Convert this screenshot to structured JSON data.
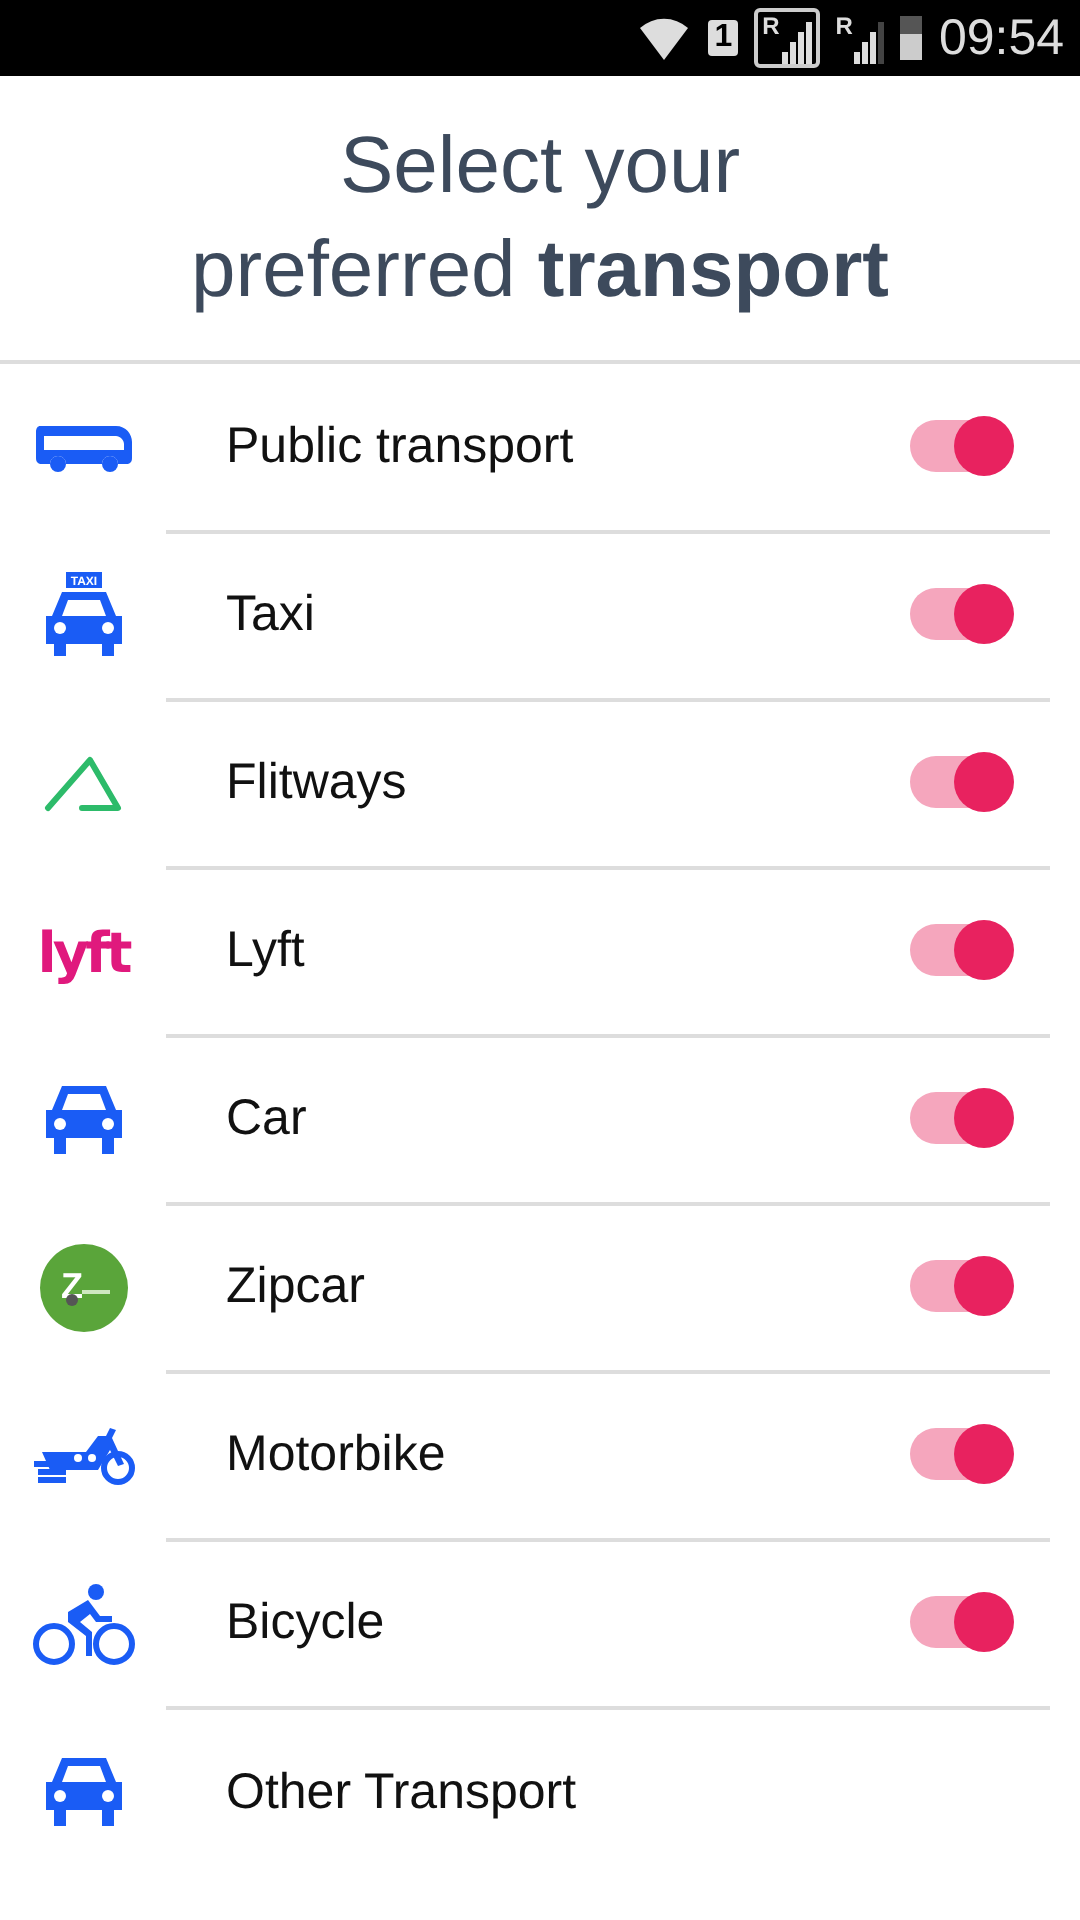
{
  "status_bar": {
    "sim_slot": "1",
    "roaming_marks": [
      "R",
      "R"
    ],
    "time": "09:54"
  },
  "title": "Select your\npreferred **transport**",
  "options": [
    {
      "label": "Public transport",
      "on": true
    },
    {
      "label": "Taxi",
      "icon_text": "TAXI",
      "on": true
    },
    {
      "label": "Flitways",
      "on": true
    },
    {
      "label": "Lyft",
      "icon_text": "lyft",
      "on": true
    },
    {
      "label": "Car",
      "on": true
    },
    {
      "label": "Zipcar",
      "icon_text": "Z",
      "on": true
    },
    {
      "label": "Motorbike",
      "on": true
    },
    {
      "label": "Bicycle",
      "on": true
    },
    {
      "label": "Other Transport"
    }
  ]
}
